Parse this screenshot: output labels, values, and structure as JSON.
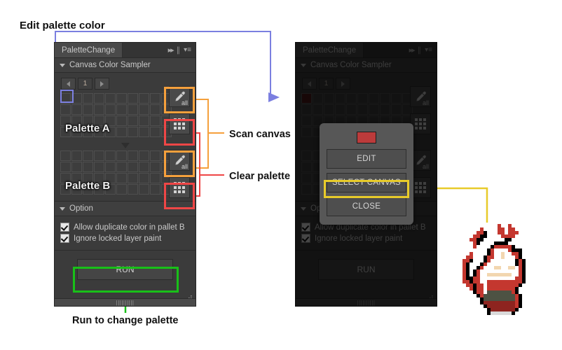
{
  "annotations": {
    "edit_palette_color": "Edit palette color",
    "scan_canvas": "Scan canvas",
    "clear_palette": "Clear palette",
    "run_to_change_palette": "Run to change palette"
  },
  "colors": {
    "edit_line": "#7b7fe0",
    "scan_line": "#f5a03c",
    "clear_line": "#ef4646",
    "run_line": "#18c018",
    "select_canvas_line": "#e8cb2a",
    "panel_bg": "#3b3b3b",
    "swatch_red": "#bc3b3b",
    "swatch_dark_red": "#5c1414"
  },
  "left_panel": {
    "tab_title": "PaletteChange",
    "tab_icons": {
      "expand": "double-chevron-icon",
      "menu": "panel-menu-icon"
    },
    "section_title": "Canvas Color Sampler",
    "pager": {
      "prev": "prev-arrow",
      "page": "1",
      "next": "next-arrow"
    },
    "palette_a": {
      "label": "Palette A",
      "columns": 10,
      "rows": 4,
      "selected_cell": 0
    },
    "palette_b": {
      "label": "Palette B",
      "columns": 10,
      "rows": 4
    },
    "side_buttons": {
      "scan_a": "eyedropper-all",
      "clear_a": "grid-3x3",
      "scan_b": "eyedropper-all",
      "clear_b": "grid-3x3",
      "eyedropper_sub_label": "all"
    },
    "option_section_title": "Option",
    "options": [
      {
        "label": "Allow duplicate color in pallet B",
        "checked": true
      },
      {
        "label": "Ignore locked layer paint",
        "checked": true
      }
    ],
    "run_label": "RUN"
  },
  "right_panel": {
    "tab_title": "PaletteChange",
    "section_title": "Canvas Color Sampler",
    "pager": {
      "page": "1"
    },
    "palette_a": {
      "label": "",
      "columns": 10,
      "rows": 4,
      "filled_cell_color": "#5c1414"
    },
    "option_section_title": "Option",
    "options": [
      {
        "label": "Allow duplicate color in pallet B",
        "checked": true
      },
      {
        "label": "Ignore locked layer paint",
        "checked": true
      }
    ],
    "run_label": "RUN",
    "dialog": {
      "swatch_color": "#bc3b3b",
      "buttons": [
        {
          "label": "EDIT",
          "highlighted": false
        },
        {
          "label": "SELECT CANVAS",
          "highlighted": true
        },
        {
          "label": "CLOSE",
          "highlighted": false
        }
      ]
    }
  },
  "sprite": {
    "name": "pixel-art-character",
    "pixel_size": 5,
    "palette": [
      "#00000000",
      "#000000",
      "#ffffff",
      "#c4372f",
      "#8e241f",
      "#5a1512",
      "#e8b98a",
      "#f2d6b0",
      "#4d5243",
      "#2f2a22",
      "#6b4a2a",
      "#d9d9d9",
      "#a02a22",
      "#3a3a32",
      "#7a5a3a"
    ],
    "rows": [
      "000000000000000000",
      "000000000030030000",
      "000003000033033000",
      "000033100033033300",
      "000331100003333000",
      "003311000000110000",
      "000310000111100000",
      "000300001333331000",
      "000000013222231110",
      "003000013227223310",
      "033000133227222310",
      "331000132222222131",
      "310001322222222131",
      "310013222772277231",
      "310132222222222231",
      "310132277777772231",
      "311332222222222331",
      "331332233333333331",
      "033133233333333310",
      "003133233333333100",
      "000133288888883100",
      "000013888888888310",
      "000001888888888310",
      "000001444444444310",
      "000000144444444310",
      "000000014444444100",
      "00000001bbbbbb1000",
      "000000000000000000"
    ]
  }
}
